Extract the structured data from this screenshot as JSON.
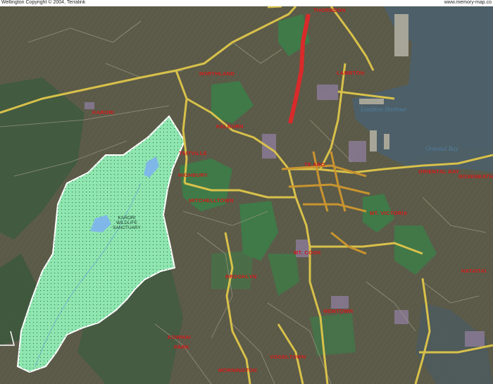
{
  "header": {
    "left": "Wellington  Copyright © 2004, Terralink",
    "right": "www.memory-map.co"
  },
  "colors": {
    "land": "#5b5a48",
    "water": "#4d5f68",
    "park": "#3f7a48",
    "sanctuary": "#8fe6b0",
    "road": "#d8c14a",
    "label": "#d21a1a",
    "rail": "#d92a2a"
  },
  "suburbs": {
    "thorndon": "THORNDON",
    "northland": "NORTHLAND",
    "lambton": "LAMBTON",
    "karori": "KARORI",
    "kelburn": "KELBURN",
    "highbury": "HIGHBURY",
    "mitchelltown": "MITCHELLTOWN",
    "te_aro": "TE ARO",
    "oriental_bay": "ORIENTAL BAY",
    "roseneath": "ROSENEATH",
    "mt_victoria": "MT. VICTORIA",
    "mt_cook": "MT. COOK",
    "brooklyn": "BROOKLYN",
    "newtown": "NEWTOWN",
    "hataitai": "HATAITAI",
    "kowhai": "KOWHAI",
    "park": "PARK",
    "mornington": "MORNINGTON",
    "vogeltown": "VOGELTOWN"
  },
  "water_labels": {
    "lambton_harbour": "Lambton Harbour",
    "oriental_bay": "Oriental Bay"
  },
  "sanctuary": {
    "line1": "KARORI",
    "line2": "WILDLIFE",
    "line3": "SANCTUARY"
  }
}
